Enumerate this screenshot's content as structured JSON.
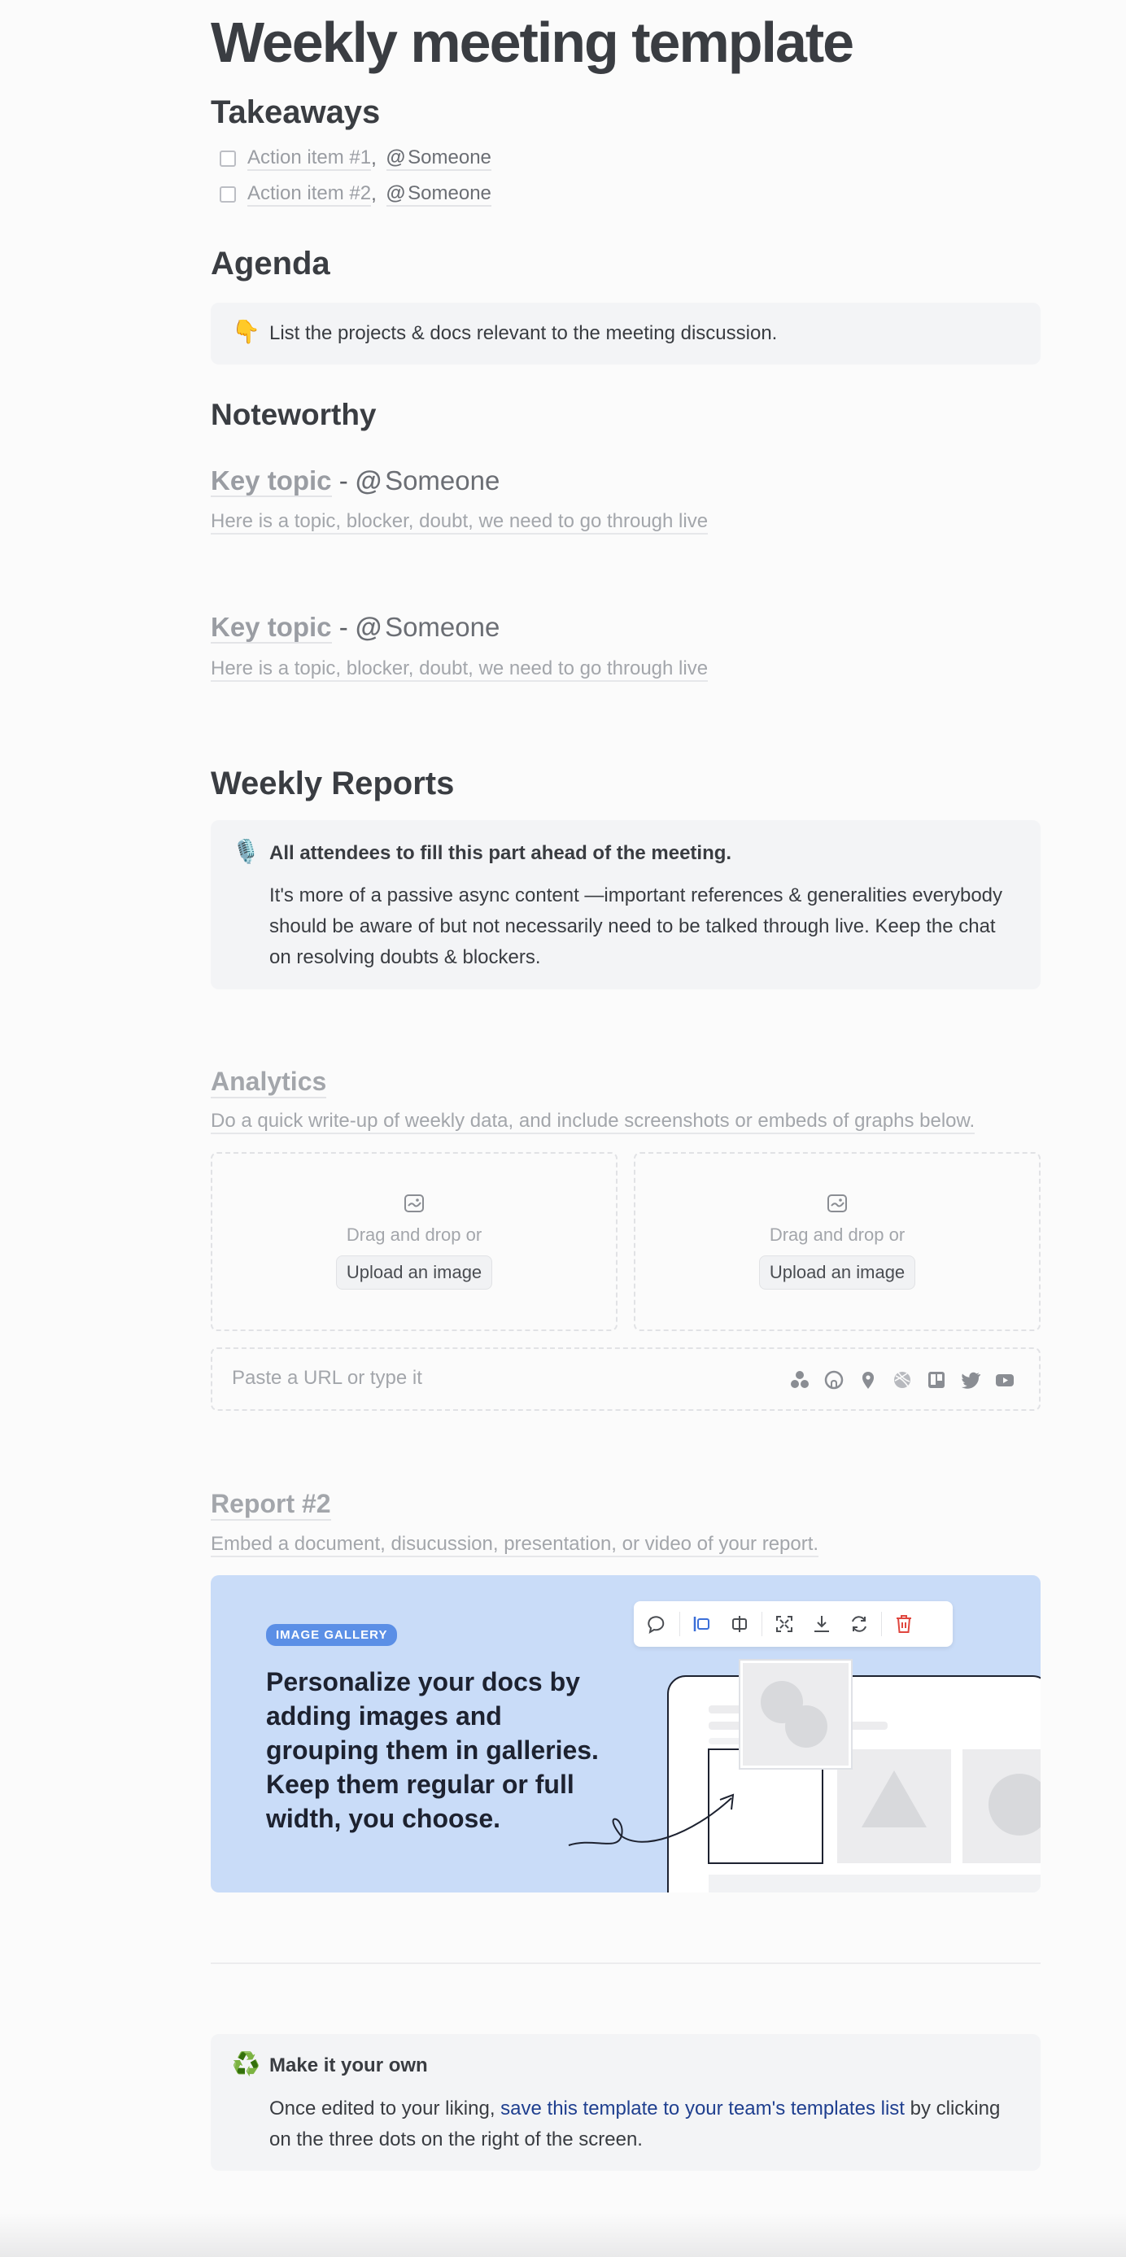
{
  "doc": {
    "title": "Weekly meeting template"
  },
  "takeaways": {
    "heading": "Takeaways",
    "items": [
      {
        "label": "Action item #1",
        "separator": ",",
        "mention_at": "@",
        "mention": "Someone"
      },
      {
        "label": "Action item #2",
        "separator": ",",
        "mention_at": "@",
        "mention": "Someone"
      }
    ]
  },
  "agenda": {
    "heading": "Agenda",
    "callout_emoji": "👇",
    "callout_text": "List the projects & docs relevant to the meeting discussion."
  },
  "noteworthy": {
    "heading": "Noteworthy",
    "topics": [
      {
        "title": "Key topic",
        "dash": " - ",
        "mention_at": "@",
        "mention": "Someone",
        "description": "Here is a topic, blocker, doubt, we need to go through live"
      },
      {
        "title": "Key topic",
        "dash": " - ",
        "mention_at": "@",
        "mention": "Someone",
        "description": "Here is a topic, blocker, doubt, we need to go through live"
      }
    ]
  },
  "weekly_reports": {
    "heading": "Weekly Reports",
    "callout_emoji": "🎙️",
    "callout_title": "All attendees to fill this part ahead of the meeting.",
    "callout_body": "It's more of a passive async content —important references & generalities everybody should be aware of but not necessarily need to be talked through live. Keep the chat on resolving doubts & blockers."
  },
  "analytics": {
    "heading": "Analytics",
    "description": "Do a quick write-up of weekly data, and include screenshots or embeds of graphs below.",
    "uploads": [
      {
        "drag_text": "Drag and drop or",
        "button_label": "Upload an image"
      },
      {
        "drag_text": "Drag and drop or",
        "button_label": "Upload an image"
      }
    ],
    "embed_placeholder": "Paste a URL or type it",
    "embed_icons": [
      "figma-icon",
      "github-icon",
      "map-pin-icon",
      "dribbble-icon",
      "trello-icon",
      "twitter-icon",
      "youtube-icon"
    ]
  },
  "report2": {
    "heading": "Report #2",
    "description": "Embed a document, disucussion, presentation, or video of your report.",
    "gallery": {
      "badge": "IMAGE GALLERY",
      "headline": "Personalize your docs by adding images and grouping them in galleries. Keep them regular or full width, you choose.",
      "background_color": "#c9dcf8",
      "toolbar_icons": [
        "comment-icon",
        "align-left-icon",
        "align-center-icon",
        "fullscreen-icon",
        "download-icon",
        "replace-icon",
        "delete-icon"
      ]
    }
  },
  "footer_callout": {
    "emoji": "♻️",
    "title": "Make it your own",
    "body_prefix": "Once edited to your liking, ",
    "link_text": "save this template to your team's templates list",
    "body_suffix": " by clicking on the three dots on the right of the screen."
  },
  "colors": {
    "page_background": "#fbfbfb",
    "callout_background": "#f3f4f6",
    "link": "#1f3f8f",
    "badge": "#5b8fe6",
    "delete": "#e0463e"
  }
}
